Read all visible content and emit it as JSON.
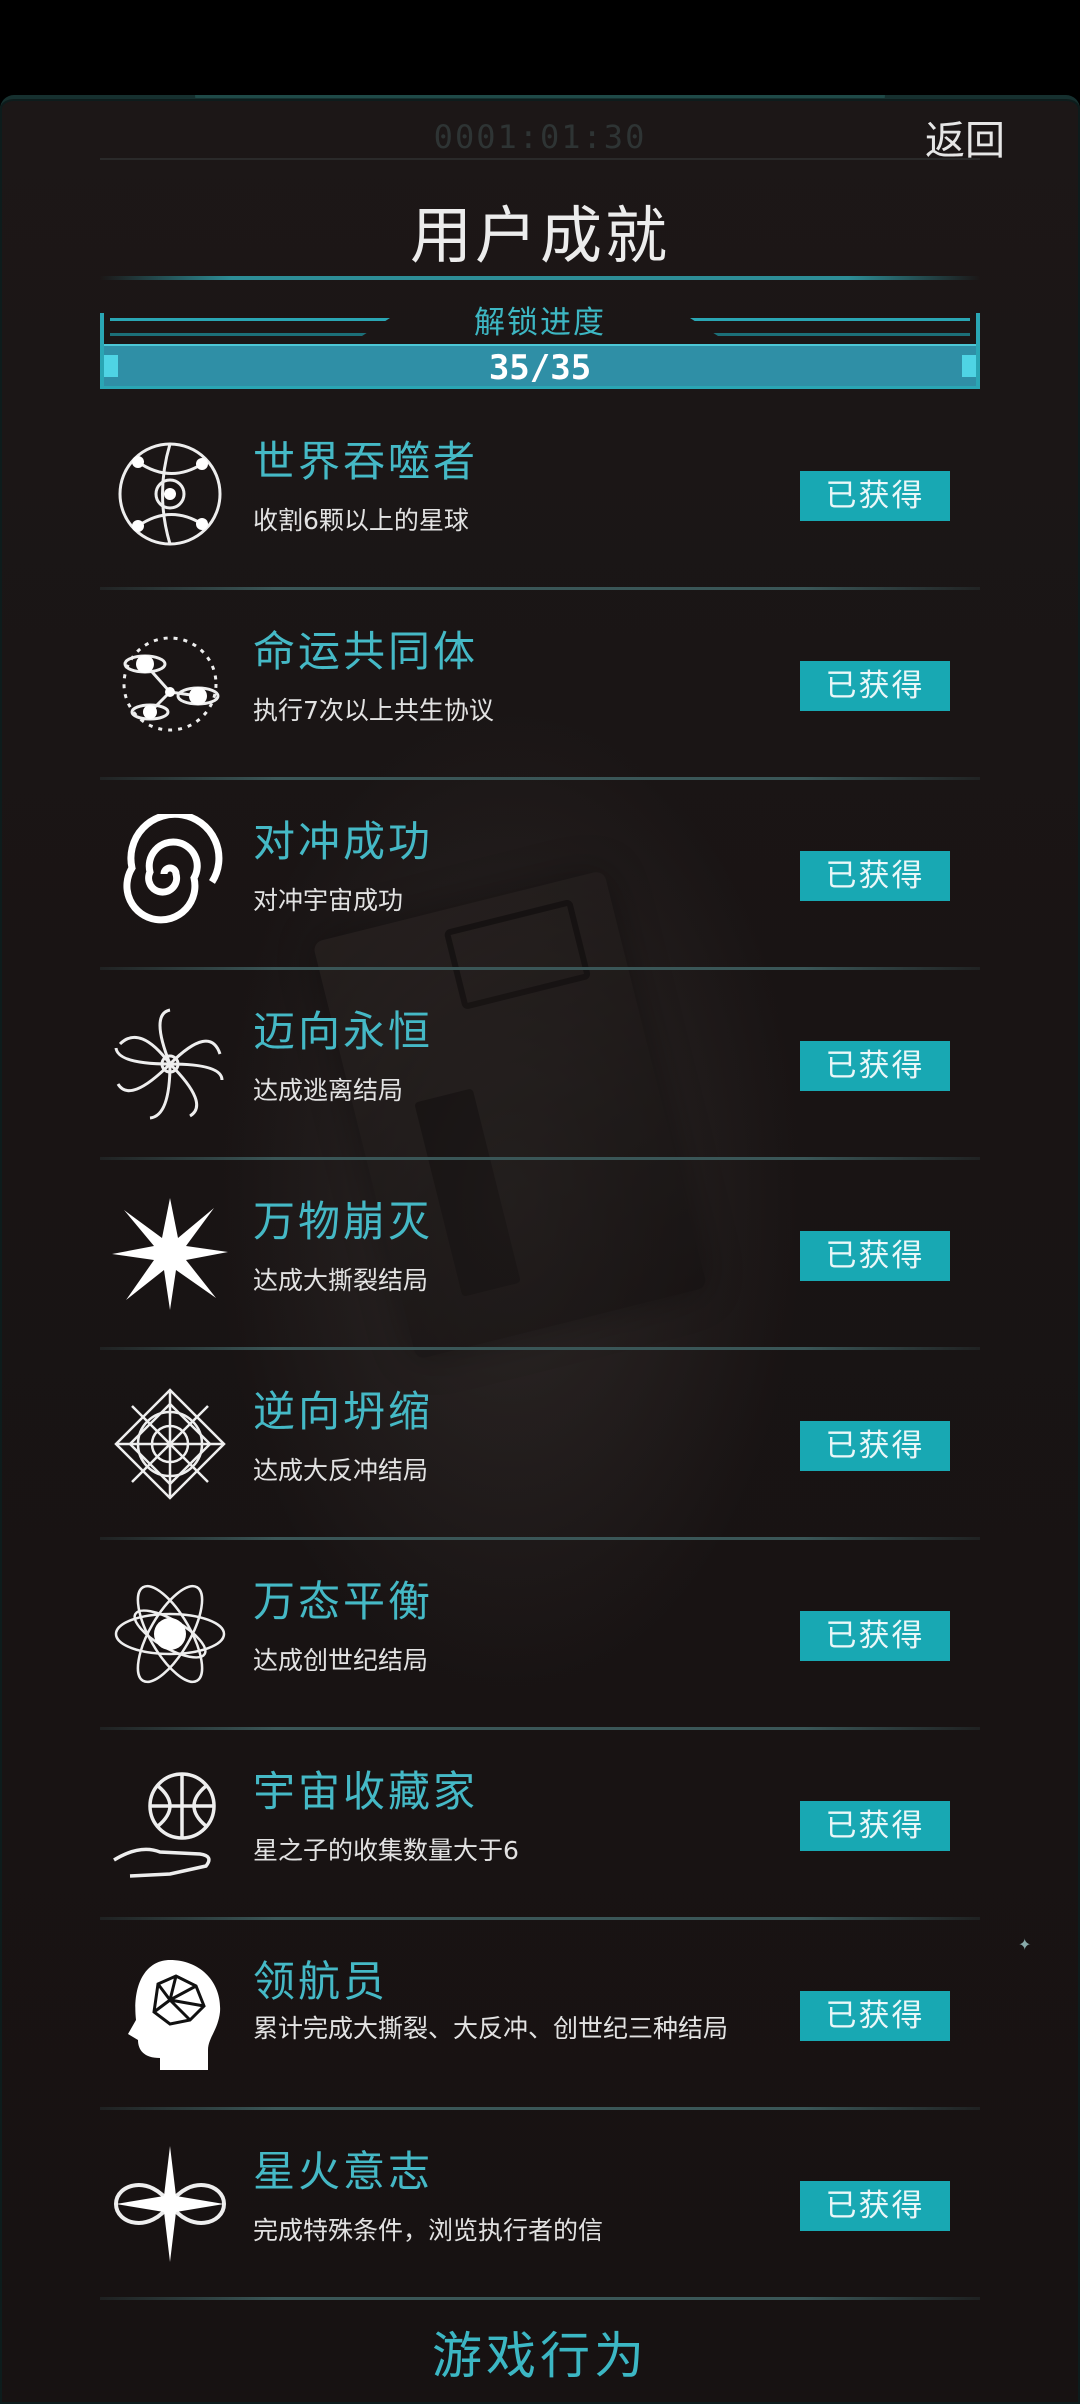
{
  "header": {
    "clock": "0001:01:30",
    "back_label": "返回",
    "title": "用户成就"
  },
  "progress": {
    "label": "解锁进度",
    "text": "35/35",
    "unlocked": 35,
    "total": 35,
    "fraction": 1.0
  },
  "achievements": [
    {
      "name": "世界吞噬者",
      "desc": "收割6颗以上的星球",
      "status": "已获得",
      "icon": "orbit-system-icon"
    },
    {
      "name": "命运共同体",
      "desc": "执行7次以上共生协议",
      "status": "已获得",
      "icon": "linked-planets-icon"
    },
    {
      "name": "对冲成功",
      "desc": "对冲宇宙成功",
      "status": "已获得",
      "icon": "spiral-swirl-icon"
    },
    {
      "name": "迈向永恒",
      "desc": "达成逃离结局",
      "status": "已获得",
      "icon": "vortex-icon"
    },
    {
      "name": "万物崩灭",
      "desc": "达成大撕裂结局",
      "status": "已获得",
      "icon": "burst-icon"
    },
    {
      "name": "逆向坍缩",
      "desc": "达成大反冲结局",
      "status": "已获得",
      "icon": "mandala-icon"
    },
    {
      "name": "万态平衡",
      "desc": "达成创世纪结局",
      "status": "已获得",
      "icon": "atom-orbits-icon"
    },
    {
      "name": "宇宙收藏家",
      "desc": "星之子的收集数量大于6",
      "status": "已获得",
      "icon": "hand-globe-icon"
    },
    {
      "name": "领航员",
      "desc": "累计完成大撕裂、大反冲、创世纪三种结局",
      "status": "已获得",
      "icon": "brain-head-icon"
    },
    {
      "name": "星火意志",
      "desc": "完成特殊条件，浏览执行者的信",
      "status": "已获得",
      "icon": "infinity-star-icon"
    }
  ],
  "footer": {
    "title": "游戏行为"
  },
  "colors": {
    "accent": "#45b9c6",
    "badge": "#18a8b3",
    "background": "#1a1515"
  }
}
